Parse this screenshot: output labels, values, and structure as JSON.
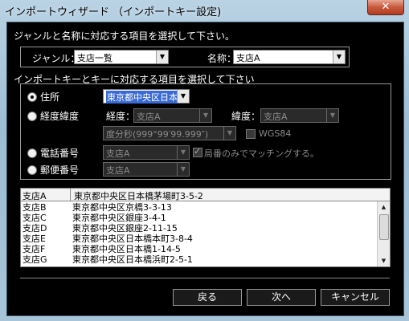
{
  "window": {
    "title": "インポートウィザード （インポートキー設定)",
    "close_label": "✕"
  },
  "section1": {
    "instruction": "ジャンルと名称に対応する項目を選択して下さい。",
    "genre_label": "ジャンル：",
    "genre_value": "支店一覧",
    "name_label": "名称：",
    "name_value": "支店A"
  },
  "section2": {
    "instruction": "インポートキーとキーに対応する項目を選択して下さい",
    "address_label": "住所",
    "address_value": "東京都中央区日本",
    "latlon_label": "経度緯度",
    "lon_label": "経度：",
    "lon_value": "支店A",
    "lat_label": "緯度：",
    "lat_value": "支店A",
    "format_value": "度分秒(999°99′99.999″)",
    "wgs_label": "WGS84",
    "phone_label": "電話番号",
    "phone_value": "支店A",
    "local_match_label": "局番のみでマッチングする。",
    "postal_label": "郵便番号",
    "postal_value": "支店A"
  },
  "table": {
    "header": {
      "col1": "支店A",
      "col2": "東京都中央区日本橋茅場町3-5-2"
    },
    "rows": [
      {
        "col1": "支店B",
        "col2": "東京都中央区京橋3-3-13"
      },
      {
        "col1": "支店C",
        "col2": "東京都中央区銀座3-4-1"
      },
      {
        "col1": "支店D",
        "col2": "東京都中央区銀座2-11-15"
      },
      {
        "col1": "支店E",
        "col2": "東京都中央区日本橋本町3-8-4"
      },
      {
        "col1": "支店F",
        "col2": "東京都中央区日本橋1-14-5"
      },
      {
        "col1": "支店G",
        "col2": "東京都中央区日本橋浜町2-5-1"
      }
    ]
  },
  "buttons": {
    "back": "戻る",
    "next": "次へ",
    "cancel": "キャンセル"
  }
}
